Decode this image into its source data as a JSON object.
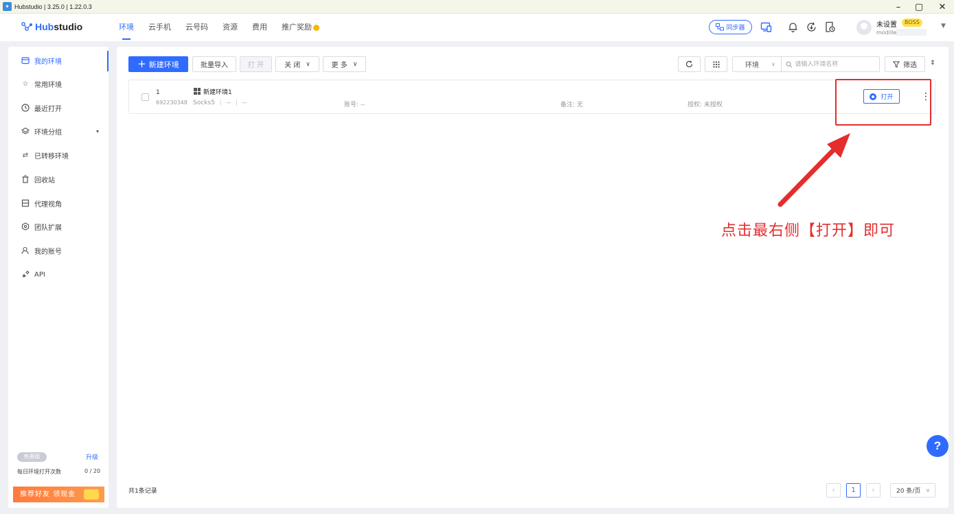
{
  "window": {
    "title": "Hubstudio | 3.25.0 | 1.22.0.3",
    "minimize": "–",
    "maximize": "▢",
    "close": "✕"
  },
  "header": {
    "logo_prefix": "Hub",
    "logo_suffix": "studio",
    "nav": [
      "环境",
      "云手机",
      "云号码",
      "资源",
      "费用",
      "推广奖励"
    ],
    "active_nav": "环境",
    "sync_label": "同步器",
    "user_name": "未设置",
    "user_badge": "BOSS",
    "user_sub": "modiller"
  },
  "sidebar": {
    "items": [
      {
        "label": "我的环境",
        "icon": "home-icon"
      },
      {
        "label": "常用环境",
        "icon": "star-icon"
      },
      {
        "label": "最近打开",
        "icon": "clock-icon"
      },
      {
        "label": "环境分组",
        "icon": "group-icon"
      },
      {
        "label": "已转移环境",
        "icon": "transfer-icon"
      },
      {
        "label": "回收站",
        "icon": "trash-icon"
      },
      {
        "label": "代理视角",
        "icon": "proxy-icon"
      },
      {
        "label": "团队扩展",
        "icon": "team-icon"
      },
      {
        "label": "我的账号",
        "icon": "user-icon"
      },
      {
        "label": "API",
        "icon": "api-icon"
      }
    ],
    "plan_badge": "免费版",
    "upgrade_label": "升级",
    "daily_label": "每日环境打开次数",
    "daily_count": "0 / 20",
    "invite_label": "推荐好友 领现金"
  },
  "toolbar": {
    "new_env": "新建环境",
    "batch_import": "批量导入",
    "open": "打 开",
    "close": "关 闭",
    "more": "更 多",
    "search_scope": "环境",
    "search_placeholder": "请输入环境名称",
    "filter": "筛选"
  },
  "environments": [
    {
      "index": "1",
      "id": "692230348",
      "name": "新建环境1",
      "proxy": "Socks5",
      "proxy_host": "--",
      "proxy_extra": "--",
      "account": "账号: --",
      "note": "备注: 无",
      "auth": "授权: 未授权",
      "open_label": "打开"
    }
  ],
  "annotation": "点击最右侧【打开】即可",
  "pagination": {
    "total": "共1条记录",
    "current_page": "1",
    "page_size": "20 条/页"
  },
  "colors": {
    "accent": "#2f6bff",
    "annotation": "#e52d2d"
  }
}
